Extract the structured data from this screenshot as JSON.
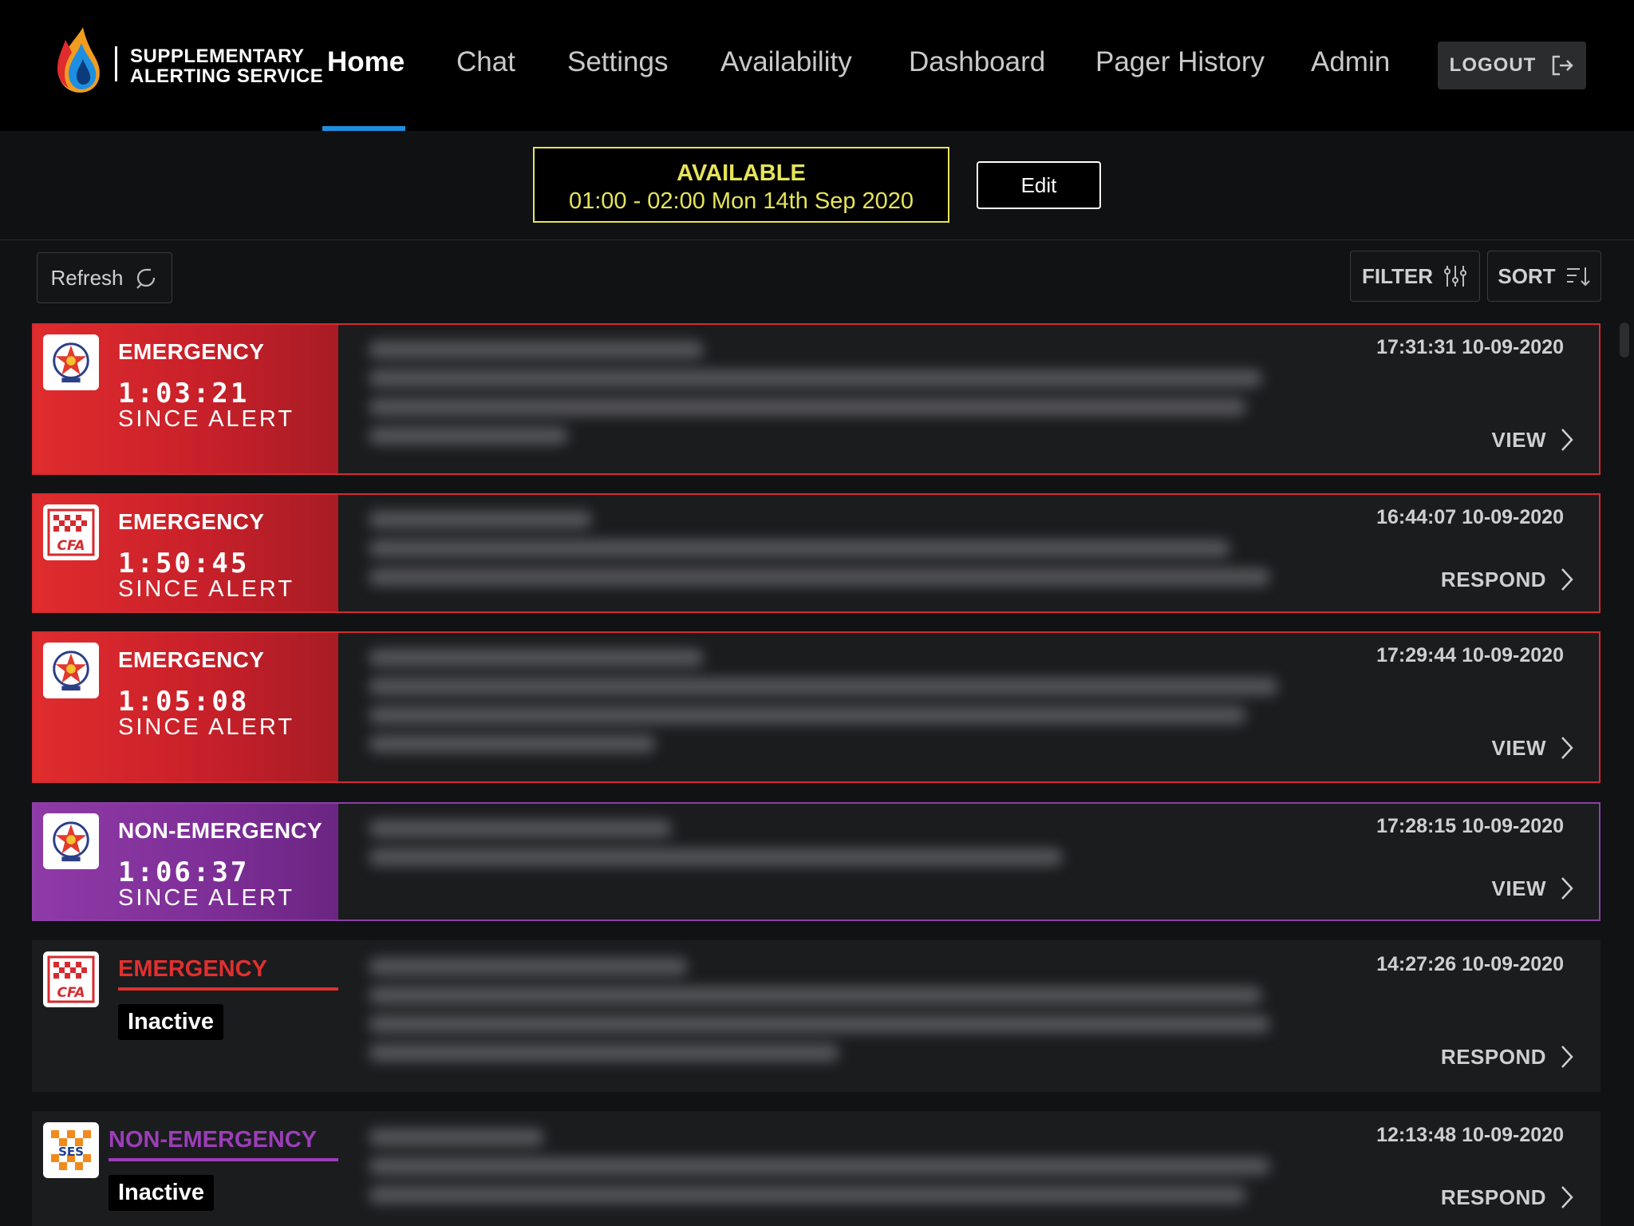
{
  "header": {
    "brand_line1": "SUPPLEMENTARY",
    "brand_line2": "ALERTING SERVICE",
    "nav": [
      {
        "label": "Home",
        "active": true
      },
      {
        "label": "Chat",
        "active": false
      },
      {
        "label": "Settings",
        "active": false
      },
      {
        "label": "Availability",
        "active": false
      },
      {
        "label": "Dashboard",
        "active": false
      },
      {
        "label": "Pager History",
        "active": false
      },
      {
        "label": "Admin",
        "active": false
      }
    ],
    "logout_label": "LOGOUT"
  },
  "availability": {
    "status": "AVAILABLE",
    "time": "01:00 - 02:00  Mon 14th Sep 2020",
    "edit_label": "Edit",
    "color": "#e6e45a"
  },
  "toolbar": {
    "refresh_label": "Refresh",
    "filter_label": "FILTER",
    "sort_label": "SORT"
  },
  "colors": {
    "emergency": "#d62a2e",
    "non_emergency": "#8a3fa6",
    "nav_active_underline": "#1e8fe0"
  },
  "alerts": [
    {
      "agency": "VICPOL",
      "type": "EMERGENCY",
      "timer": "1:03:21",
      "since": "SINCE ALERT",
      "timestamp": "17:31:31 10-09-2020",
      "action": "VIEW",
      "active": true
    },
    {
      "agency": "CFA",
      "type": "EMERGENCY",
      "timer": "1:50:45",
      "since": "SINCE ALERT",
      "timestamp": "16:44:07 10-09-2020",
      "action": "RESPOND",
      "active": true
    },
    {
      "agency": "VICPOL",
      "type": "EMERGENCY",
      "timer": "1:05:08",
      "since": "SINCE ALERT",
      "timestamp": "17:29:44 10-09-2020",
      "action": "VIEW",
      "active": true
    },
    {
      "agency": "VICPOL",
      "type": "NON-EMERGENCY",
      "timer": "1:06:37",
      "since": "SINCE ALERT",
      "timestamp": "17:28:15 10-09-2020",
      "action": "VIEW",
      "active": true
    },
    {
      "agency": "CFA",
      "type": "EMERGENCY",
      "status": "Inactive",
      "timestamp": "14:27:26 10-09-2020",
      "action": "RESPOND",
      "active": false
    },
    {
      "agency": "SES",
      "type": "NON-EMERGENCY",
      "status": "Inactive",
      "timestamp": "12:13:48 10-09-2020",
      "action": "RESPOND",
      "active": false
    }
  ],
  "badge_text": {
    "cfa": "CFA",
    "ses": "SES"
  }
}
